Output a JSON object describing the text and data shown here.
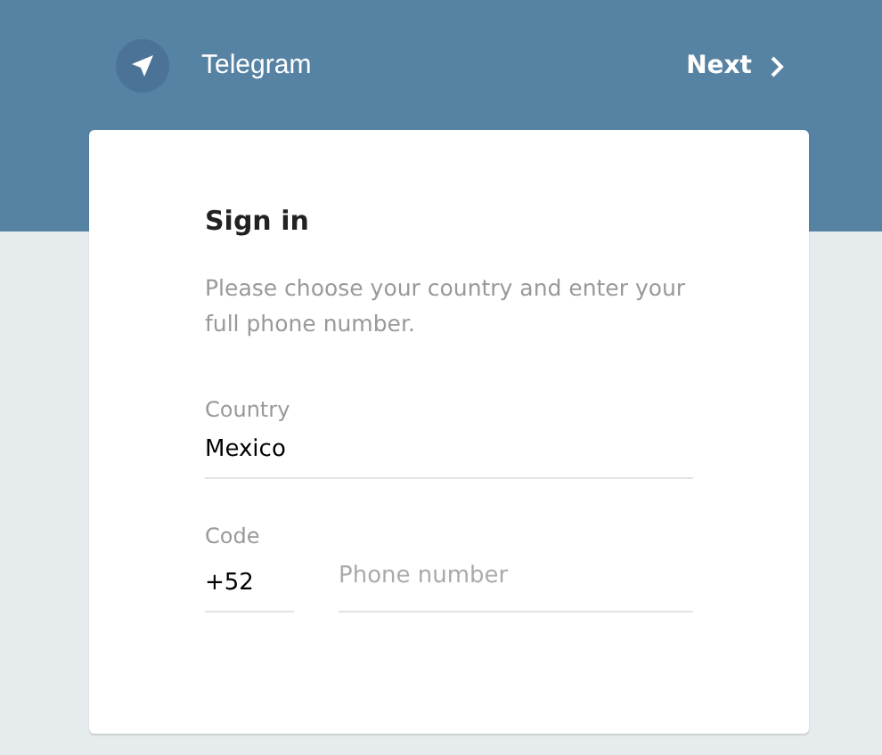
{
  "header": {
    "app_name": "Telegram",
    "next_button": "Next"
  },
  "card": {
    "title": "Sign in",
    "description": "Please choose your country and enter your full phone number.",
    "country": {
      "label": "Country",
      "value": "Mexico"
    },
    "code": {
      "label": "Code",
      "value": "+52"
    },
    "phone": {
      "placeholder": "Phone number"
    }
  }
}
